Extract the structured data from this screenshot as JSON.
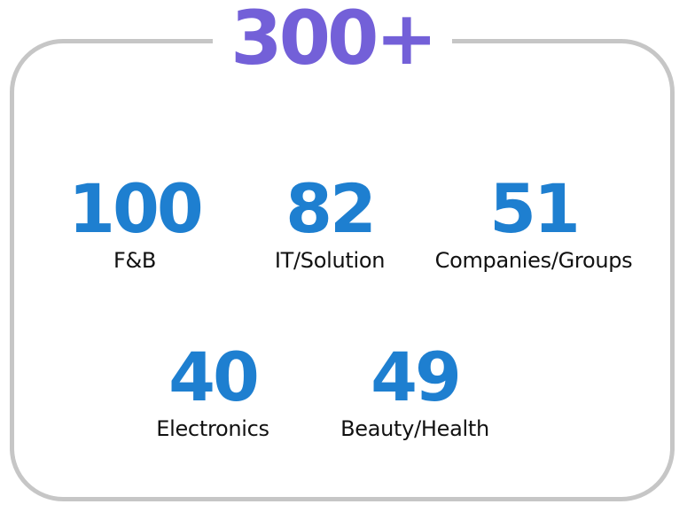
{
  "headline": "300+",
  "stats": [
    {
      "value": "100",
      "label": "F&B"
    },
    {
      "value": "82",
      "label": "IT/Solution"
    },
    {
      "value": "51",
      "label": "Companies/Groups"
    },
    {
      "value": "40",
      "label": "Electronics"
    },
    {
      "value": "49",
      "label": "Beauty/Health"
    }
  ],
  "colors": {
    "headline": "#7360d8",
    "numbers": "#1e7fd0",
    "labels": "#111111",
    "frame": "#c6c6c6"
  }
}
